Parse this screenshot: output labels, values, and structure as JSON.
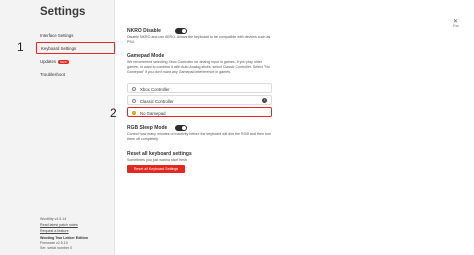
{
  "sidebar": {
    "title": "Settings",
    "items": [
      {
        "label": "Interface Settings"
      },
      {
        "label": "Keyboard Settings"
      },
      {
        "label": "Updates",
        "badge": "NEW"
      },
      {
        "label": "Troubleshoot"
      }
    ],
    "footer": {
      "software": "Wootility v4.5.14",
      "link1": "Read latest patch notes",
      "link2": "Request a feature",
      "device": "Wooting Two Lekker Edition",
      "firmware": "Firmware v2.5.10",
      "serial": "Ser. serial number 0"
    }
  },
  "annotations": {
    "marker1": "1",
    "marker2": "2"
  },
  "main": {
    "close": "✕",
    "close_hint": "Esc",
    "nkro": {
      "title": "NKRO Disable",
      "description": "Disable NKRO and use 6KRO. Allows the keyboard to be compatible with devices such as PS4."
    },
    "gamepad": {
      "title": "Gamepad Mode",
      "description": "We recommend selecting Xbox Controller for analog input in games. If you play older games, or want to combine it with Auto Analog sticks, select Classic Controller. Select \"No Gamepad\" if you don't want any Gamepad interference in games.",
      "options": [
        {
          "label": "Xbox Controller"
        },
        {
          "label": "Classic Controller"
        },
        {
          "label": "No Gamepad"
        }
      ]
    },
    "rgb": {
      "title": "RGB Sleep Mode",
      "description": "Control how many minutes of inactivity before the keyboard will dim the RGB and then turn them off completely."
    },
    "reset": {
      "title": "Reset all keyboard settings",
      "description": "Sometimes you just wanna start fresh",
      "button": "Reset all Keyboard Settings"
    }
  }
}
